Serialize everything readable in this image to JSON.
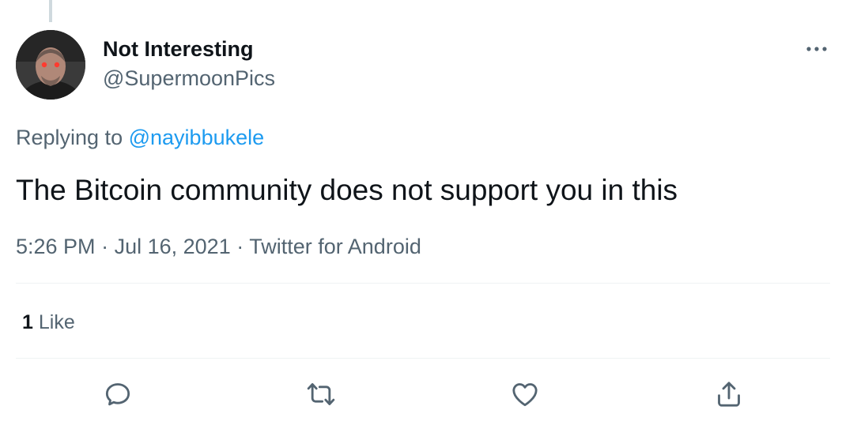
{
  "tweet": {
    "author_name": "Not Interesting",
    "author_handle": "@SupermoonPics",
    "replying_prefix": "Replying to",
    "replying_to": "@nayibbukele",
    "text": "The Bitcoin community does not support you in this",
    "time": "5:26 PM",
    "date": "Jul 16, 2021",
    "source": "Twitter for Android",
    "separator": "·",
    "like_count": "1",
    "like_label": "Like"
  },
  "icons": {
    "more": "more-horizontal-icon",
    "reply": "reply-icon",
    "retweet": "retweet-icon",
    "like": "heart-icon",
    "share": "share-icon"
  },
  "colors": {
    "accent": "#1d9bf0",
    "secondary_text": "#536471",
    "primary_text": "#0f1419",
    "divider": "#eff3f4"
  }
}
